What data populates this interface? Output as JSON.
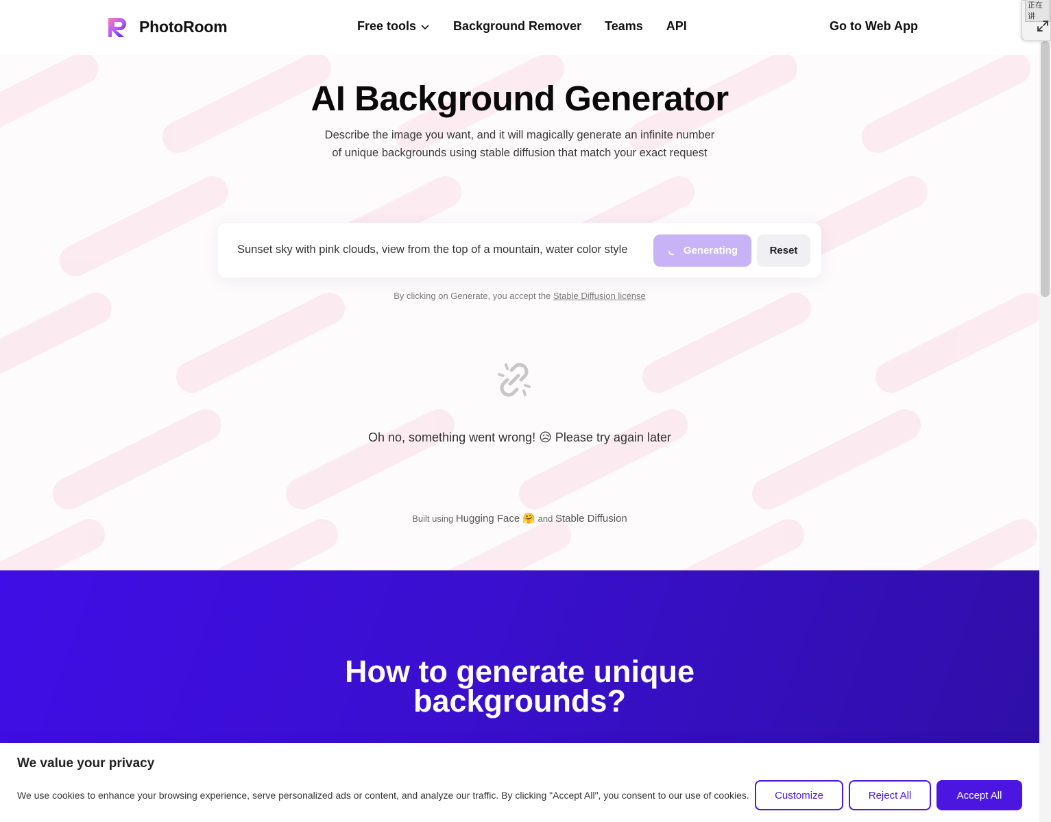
{
  "header": {
    "brand": "PhotoRoom",
    "nav": [
      {
        "label": "Free tools",
        "has_dropdown": true
      },
      {
        "label": "Background Remover"
      },
      {
        "label": "Teams"
      },
      {
        "label": "API"
      }
    ],
    "cta": "Go to Web App"
  },
  "hero": {
    "title": "AI Background Generator",
    "subtitle": "Describe the image you want, and it will magically generate an infinite number of unique backgrounds using stable diffusion that match your exact request",
    "prompt": {
      "value": "Sunset sky with pink clouds, view from the top of a mountain, water color style",
      "generate_label": "Generating",
      "reset_label": "Reset"
    },
    "license_prefix": "By clicking on Generate, you accept the ",
    "license_link": "Stable Diffusion license",
    "error_message": "Oh no, something went wrong! 😥 Please try again later",
    "built_prefix": "Built using ",
    "built_hf": "Hugging Face 🤗",
    "built_and": " and ",
    "built_sd": "Stable Diffusion"
  },
  "how": {
    "title_line1": "How to generate unique",
    "title_line2": "backgrounds?"
  },
  "cookie": {
    "title": "We value your privacy",
    "text": "We use cookies to enhance your browsing experience, serve personalized ads or content, and analyze our traffic. By clicking \"Accept All\", you consent to our use of cookies.",
    "customize": "Customize",
    "reject": "Reject All",
    "accept": "Accept All"
  },
  "widget": {
    "label": "正在讲"
  },
  "colors": {
    "accent": "#4a16e0",
    "generate_disabled": "#c8b3f6",
    "section_purple": "#3a0fce"
  }
}
